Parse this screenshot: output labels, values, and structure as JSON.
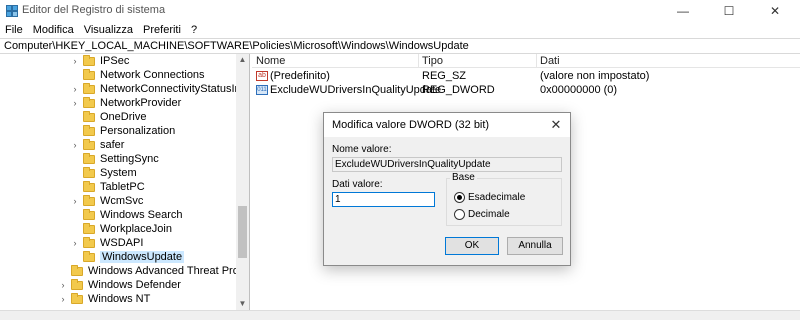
{
  "window": {
    "title": "Editor del Registro di sistema",
    "min_glyph": "—",
    "max_glyph": "☐",
    "close_glyph": "✕"
  },
  "menu": [
    "File",
    "Modifica",
    "Visualizza",
    "Preferiti",
    "?"
  ],
  "address": "Computer\\HKEY_LOCAL_MACHINE\\SOFTWARE\\Policies\\Microsoft\\Windows\\WindowsUpdate",
  "tree": {
    "items": [
      {
        "label": "IPSec",
        "indent": 1,
        "expander": true,
        "selected": false
      },
      {
        "label": "Network Connections",
        "indent": 1,
        "expander": false,
        "selected": false
      },
      {
        "label": "NetworkConnectivityStatusIndicator",
        "indent": 1,
        "expander": true,
        "selected": false
      },
      {
        "label": "NetworkProvider",
        "indent": 1,
        "expander": true,
        "selected": false
      },
      {
        "label": "OneDrive",
        "indent": 1,
        "expander": false,
        "selected": false
      },
      {
        "label": "Personalization",
        "indent": 1,
        "expander": false,
        "selected": false
      },
      {
        "label": "safer",
        "indent": 1,
        "expander": true,
        "selected": false
      },
      {
        "label": "SettingSync",
        "indent": 1,
        "expander": false,
        "selected": false
      },
      {
        "label": "System",
        "indent": 1,
        "expander": false,
        "selected": false
      },
      {
        "label": "TabletPC",
        "indent": 1,
        "expander": false,
        "selected": false
      },
      {
        "label": "WcmSvc",
        "indent": 1,
        "expander": true,
        "selected": false
      },
      {
        "label": "Windows Search",
        "indent": 1,
        "expander": false,
        "selected": false
      },
      {
        "label": "WorkplaceJoin",
        "indent": 1,
        "expander": false,
        "selected": false
      },
      {
        "label": "WSDAPI",
        "indent": 1,
        "expander": true,
        "selected": false
      },
      {
        "label": "WindowsUpdate",
        "indent": 1,
        "expander": false,
        "selected": true
      },
      {
        "label": "Windows Advanced Threat Protection",
        "indent": 0,
        "expander": false,
        "selected": false
      },
      {
        "label": "Windows Defender",
        "indent": 0,
        "expander": true,
        "selected": false
      },
      {
        "label": "Windows NT",
        "indent": 0,
        "expander": true,
        "selected": false
      }
    ]
  },
  "list": {
    "headers": {
      "name": "Nome",
      "type": "Tipo",
      "data": "Dati"
    },
    "rows": [
      {
        "icon": "string-value-icon",
        "icon_glyph": "ab",
        "name": "(Predefinito)",
        "type": "REG_SZ",
        "data": "(valore non impostato)"
      },
      {
        "icon": "dword-value-icon",
        "icon_glyph": "011",
        "name": "ExcludeWUDriversInQualityUpdate",
        "type": "REG_DWORD",
        "data": "0x00000000 (0)"
      }
    ]
  },
  "dialog": {
    "title": "Modifica valore DWORD (32 bit)",
    "close_glyph": "✕",
    "name_label": "Nome valore:",
    "name_value": "ExcludeWUDriversInQualityUpdate",
    "data_label": "Dati valore:",
    "data_value": "1",
    "base_label": "Base",
    "base_options": [
      {
        "label": "Esadecimale",
        "checked": true
      },
      {
        "label": "Decimale",
        "checked": false
      }
    ],
    "ok_label": "OK",
    "cancel_label": "Annulla"
  }
}
